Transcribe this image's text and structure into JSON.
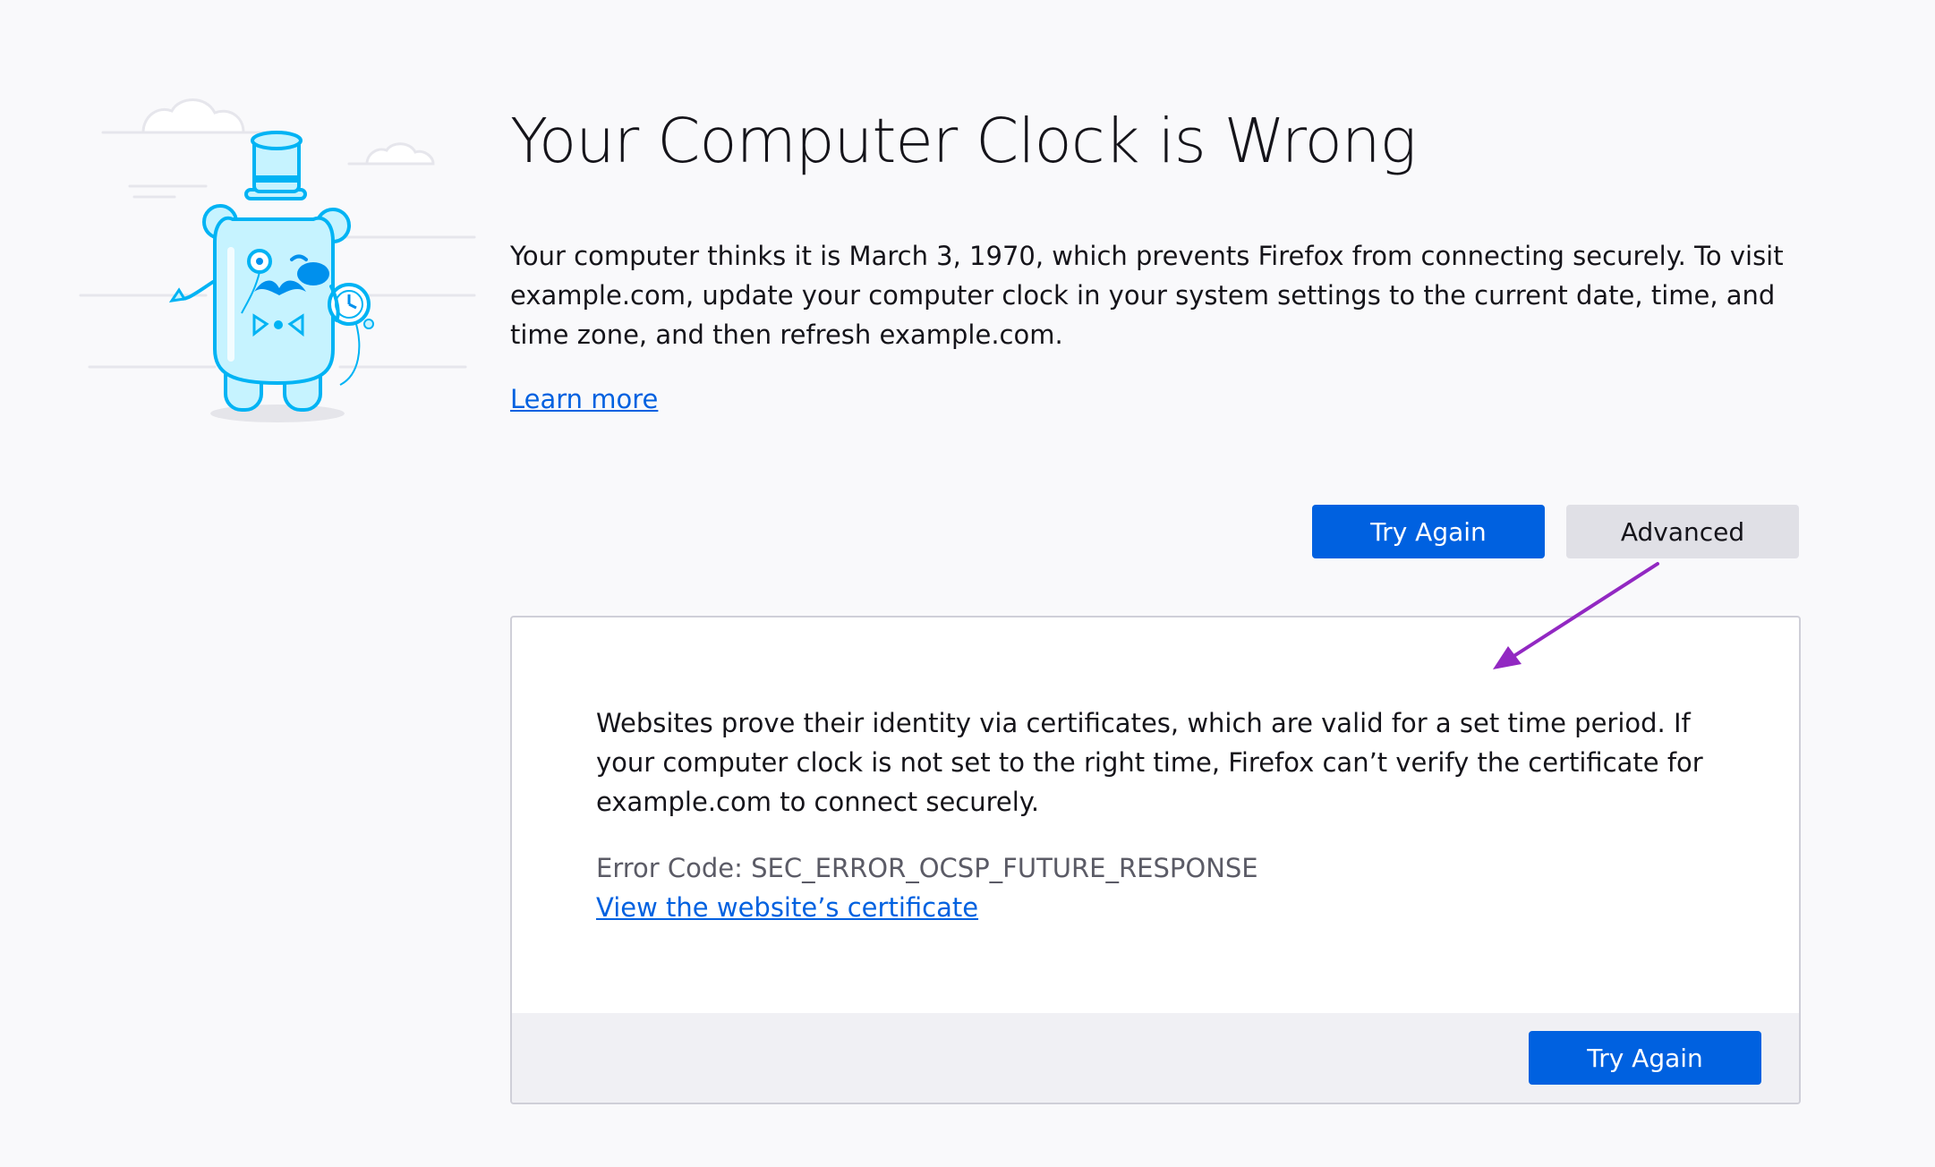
{
  "page": {
    "title": "Your Computer Clock is Wrong",
    "description": "Your computer thinks it is March 3, 1970, which prevents Firefox from connecting securely. To visit example.com, update your computer clock in your system settings to the current date, time, and time zone, and then refresh example.com.",
    "learn_more": "Learn more"
  },
  "actions": {
    "try_again": "Try Again",
    "advanced": "Advanced"
  },
  "advanced_panel": {
    "explanation": "Websites prove their identity via certificates, which are valid for a set time period. If your computer clock is not set to the right time, Firefox can’t verify the certificate for example.com to connect securely.",
    "error_code": "Error Code: SEC_ERROR_OCSP_FUTURE_RESPONSE",
    "view_certificate": "View the website’s certificate",
    "try_again": "Try Again"
  },
  "illustration": {
    "icon": "bear-mascot-with-top-hat-monocle-and-pocket-watch-icon"
  },
  "colors": {
    "background": "#f9f9fb",
    "primary_button": "#0061e0",
    "secondary_button": "#e0e0e6",
    "link": "#0061e0",
    "annotation_arrow": "#9228c2",
    "mascot_fill": "#c6f3ff",
    "mascot_outline": "#00b3f4"
  }
}
